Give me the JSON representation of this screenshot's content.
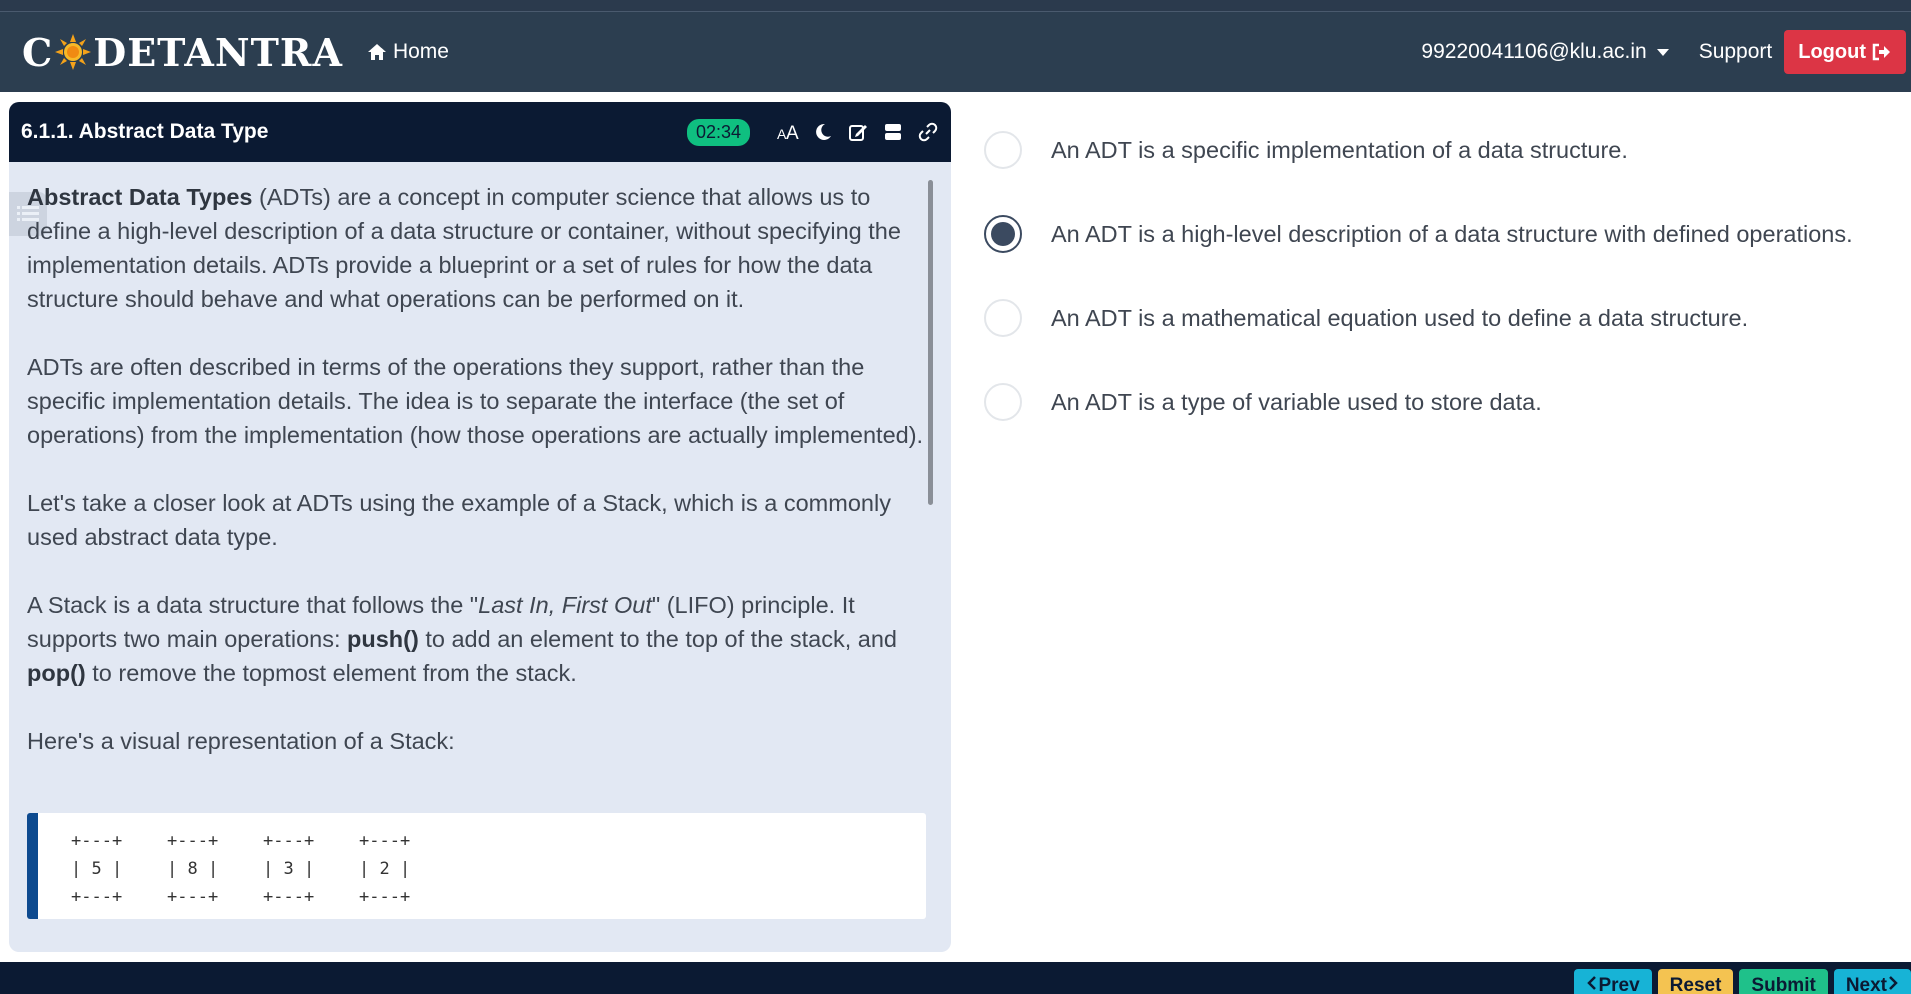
{
  "navbar": {
    "brand": {
      "prefix": "C",
      "suffix": "DETANTRA"
    },
    "home_label": "Home",
    "user_email": "99220041106@klu.ac.in",
    "support_label": "Support",
    "logout_label": "Logout"
  },
  "panel": {
    "title": "6.1.1. Abstract Data Type",
    "timer": "02:34",
    "tools": [
      "font-size-icon",
      "dark-mode-icon",
      "edit-icon",
      "layout-icon",
      "link-icon"
    ]
  },
  "content": {
    "p1": {
      "bold": "Abstract Data Types",
      "rest": " (ADTs) are a concept in computer science that allows us to define a high-level description of a data structure or container, without specifying the implementation details. ADTs provide a blueprint or a set of rules for how the data structure should behave and what operations can be performed on it."
    },
    "p2": "ADTs are often described in terms of the operations they support, rather than the specific implementation details. The idea is to separate the interface (the set of operations) from the implementation (how those operations are actually implemented).",
    "p3": "Let's take a closer look at ADTs using the example of a Stack, which is a commonly used abstract data type.",
    "p4": {
      "a": "A Stack is a data structure that follows the \"",
      "italic": "Last In, First Out",
      "b": "\" (LIFO) principle. It supports two main operations: ",
      "push": "push()",
      "c": " to add an element to the top of the stack, and ",
      "pop": "pop()",
      "d": " to remove the topmost element from the stack."
    },
    "p5": "Here's a visual representation of a Stack:",
    "code": {
      "border": "+---+",
      "cells": [
        "| 5 |",
        "| 8 |",
        "| 3 |",
        "| 2 |"
      ]
    }
  },
  "options": [
    {
      "text": "An ADT is a specific implementation of a data structure.",
      "selected": false
    },
    {
      "text": "An ADT is a high-level description of a data structure with defined operations.",
      "selected": true
    },
    {
      "text": "An ADT is a mathematical equation used to define a data structure.",
      "selected": false
    },
    {
      "text": "An ADT is a type of variable used to store data.",
      "selected": false
    }
  ],
  "footer": {
    "prev_label": "Prev",
    "reset_label": "Reset",
    "submit_label": "Submit",
    "next_label": "Next"
  },
  "colors": {
    "navbar": "#2c3e50",
    "panel_header": "#0b1a33",
    "panel_bg": "#e2e8f3",
    "logout": "#dc3545",
    "timer": "#0fbf80",
    "prev_next": "#17b3d6",
    "reset": "#f4c351",
    "submit": "#1fc18a",
    "code_accent": "#0d4a8f"
  }
}
